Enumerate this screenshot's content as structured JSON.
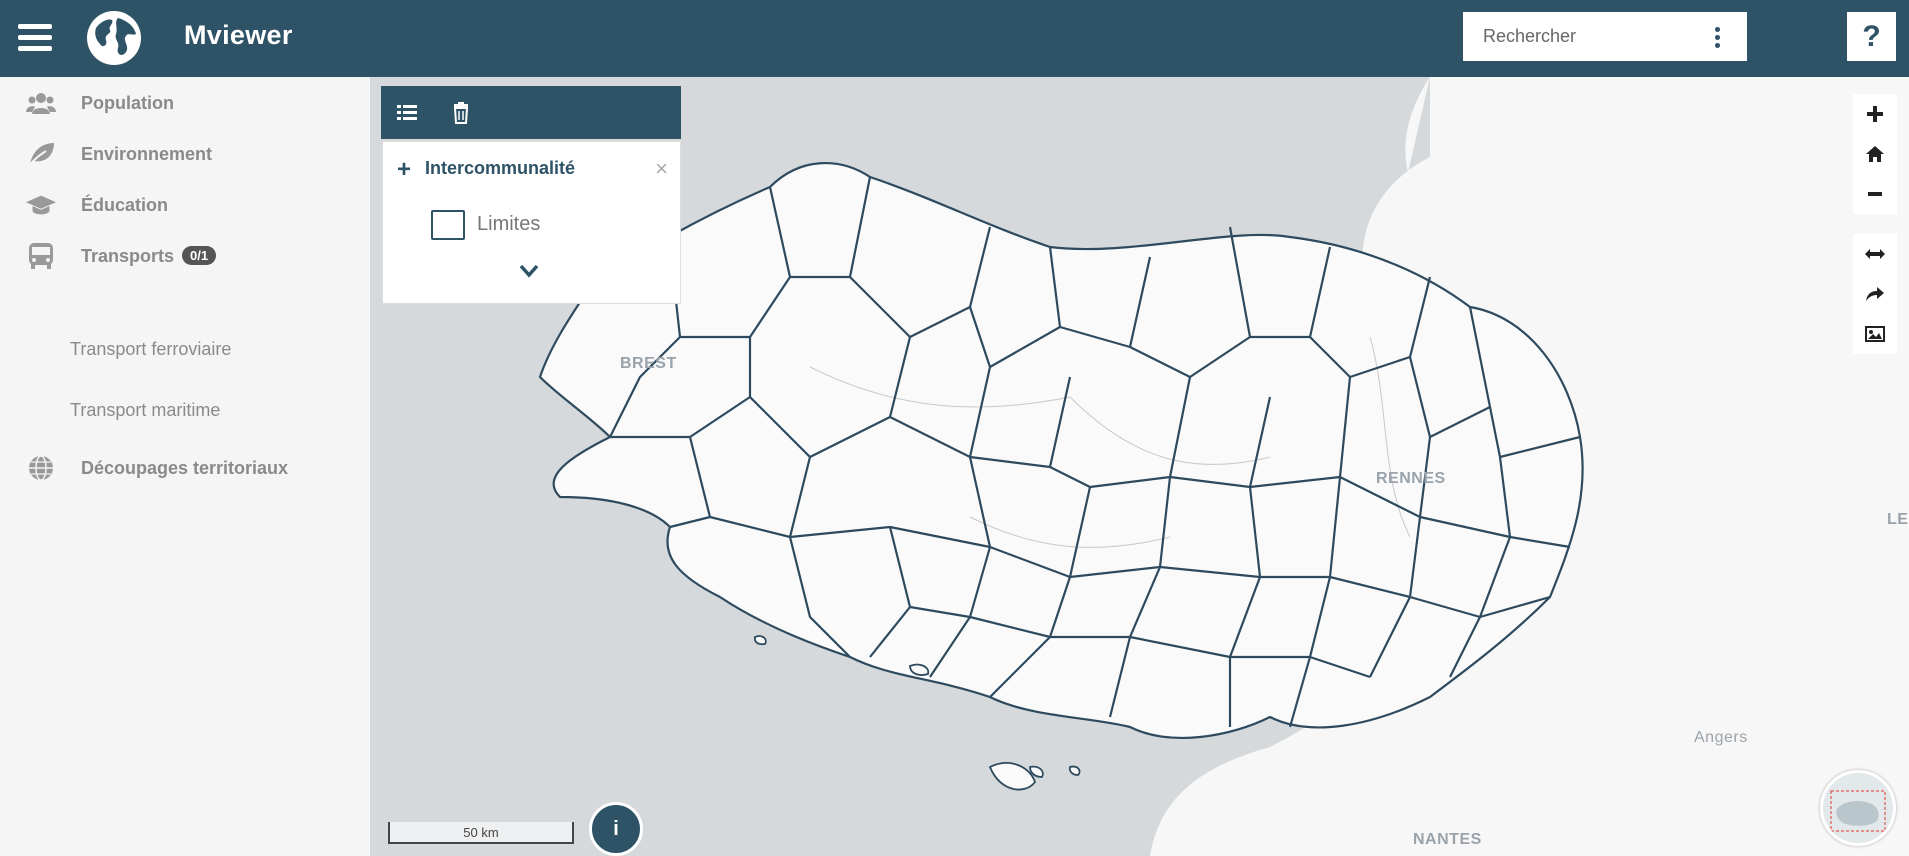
{
  "header": {
    "title": "Mviewer",
    "search_placeholder": "Rechercher",
    "help_label": "?"
  },
  "sidebar": {
    "items": [
      {
        "label": "Population",
        "icon": "users-icon"
      },
      {
        "label": "Environnement",
        "icon": "leaf-icon"
      },
      {
        "label": "Éducation",
        "icon": "graduation-cap-icon"
      },
      {
        "label": "Transports",
        "icon": "bus-icon",
        "badge": "0/1"
      },
      {
        "label": "Découpages territoriaux",
        "icon": "globe-icon"
      }
    ],
    "transport_subitems": [
      "Transport ferroviaire",
      "Transport maritime"
    ]
  },
  "layer_panel": {
    "group_title": "Intercommunalité",
    "layer_label": "Limites",
    "close_label": "×"
  },
  "map": {
    "labels": [
      "BREST",
      "RENNES",
      "Angers",
      "NANTES",
      "LE"
    ],
    "scale_label": "50 km",
    "info_label": "i"
  },
  "colors": {
    "primary": "#2e5266",
    "sea": "#d5d9db",
    "land": "#f7f7f7",
    "sidebar_text": "#8a8a8a"
  }
}
